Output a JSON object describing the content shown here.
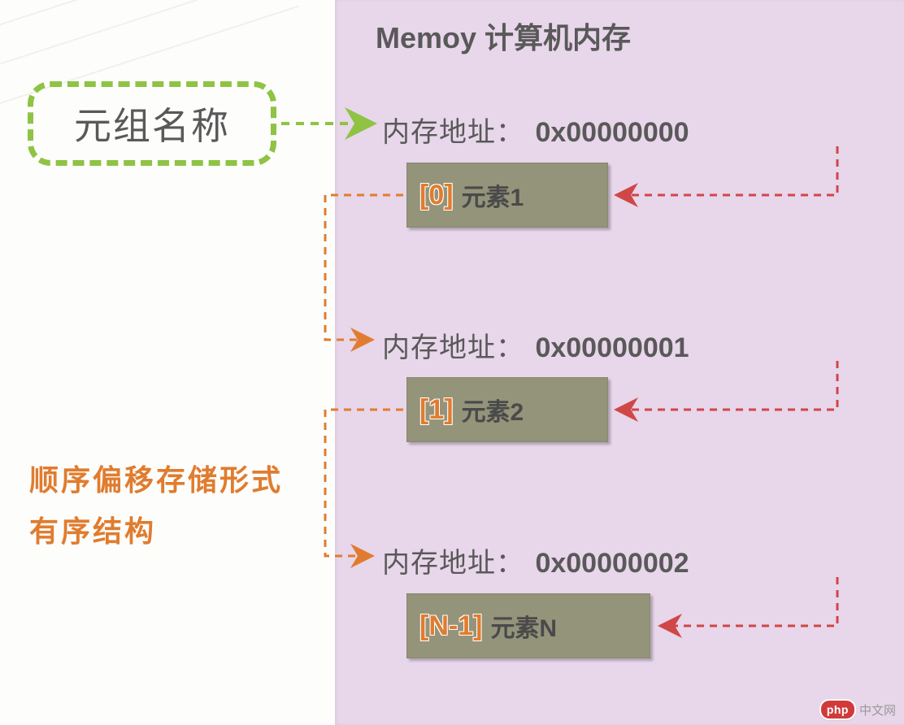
{
  "memory_title": "Memoy 计算机内存",
  "tuple_name_label": "元组名称",
  "entries": [
    {
      "addr_label": "内存地址：",
      "addr_hex": "0x00000000",
      "index_label": "[0]",
      "element_label": "元素1"
    },
    {
      "addr_label": "内存地址：",
      "addr_hex": "0x00000001",
      "index_label": "[1]",
      "element_label": "元素2"
    },
    {
      "addr_label": "内存地址：",
      "addr_hex": "0x00000002",
      "index_label": "[N-1]",
      "element_label": "元素N"
    }
  ],
  "description": {
    "line1": "顺序偏移存储形式",
    "line2": "有序结构"
  },
  "colors": {
    "panel_bg": "#e8d6ea",
    "dashed_green": "#8ec344",
    "accent_orange": "#e07c2f",
    "dashed_red": "#cf4747",
    "box_gray": "#94947b",
    "text_gray": "#595959"
  },
  "footer": {
    "pill": "php",
    "text": "中文网"
  }
}
